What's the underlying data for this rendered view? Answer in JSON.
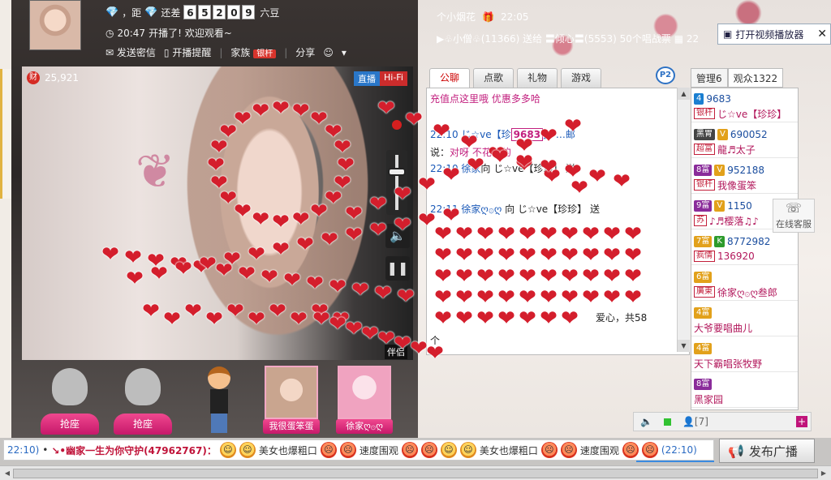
{
  "host": {
    "need_text_a": "，距",
    "need_text_b": "还差",
    "digits": [
      "6",
      "5",
      "2",
      "0",
      "9"
    ],
    "bean_text": "六豆",
    "time": "20:47",
    "status": "开播了! 欢迎观看~",
    "send_message": "发送密信",
    "start_reminder": "开播提醒",
    "family": "家族",
    "family_badge": "银杆",
    "share": "分享"
  },
  "video": {
    "wealth_icon": "财",
    "viewer_count": "25,921",
    "live_label": "直播",
    "quality_label": "Hi-Fi",
    "companion_label": "伴侣"
  },
  "seats": [
    {
      "label": "抢座"
    },
    {
      "label": "抢座"
    }
  ],
  "guards": [
    {
      "name": "我很蛋笨蛋"
    },
    {
      "name": "徐家ღ۞ღ"
    }
  ],
  "top_messages": {
    "line1_name": "个小烟花",
    "line1_time": "22:05",
    "line2": "▶♧小僧♧(11366) 送给 〓倾心〓(5553) 50个唱战票",
    "line2_tail": "22"
  },
  "player_popup": {
    "label": "打开视频播放器",
    "close": "✕"
  },
  "chat": {
    "pip_label": "P2",
    "tabs": [
      "公聊",
      "点歌",
      "礼物",
      "游戏"
    ],
    "lines": [
      {
        "pre": "",
        "text": "充值点这里哦  优惠多多哈",
        "post": ""
      },
      {
        "pre": "22:10 じ☆ve【珍",
        "text": "9683",
        "post": "】 …邮"
      },
      {
        "pre": "说：",
        "text": "对呀  不花钱的",
        "post": ""
      },
      {
        "pre": "22:10 徐家",
        "text": "",
        "post": "向 じ☆ve【珍珍】 送"
      },
      {
        "pre": "22:11 徐家ღ۞ღ",
        "text": "",
        "post": "向 じ☆ve【珍珍】 送"
      },
      {
        "pre": "",
        "text": "",
        "post": "爱心，共58"
      },
      {
        "pre": "个",
        "text": "",
        "post": ""
      }
    ]
  },
  "users_panel": {
    "tab_admin": "管理6",
    "tab_audience": "观众1322",
    "users": [
      {
        "level": "4",
        "tag": "",
        "num": "9683",
        "tag2": "银杆",
        "name": "じ☆ve【珍珍】",
        "lvclass": "bl"
      },
      {
        "level": "黑胃",
        "tag": "V",
        "num": "690052",
        "tag2": "超富",
        "name": "龍♬太子",
        "lvclass": "bk"
      },
      {
        "level": "8富",
        "tag": "V",
        "num": "952188",
        "tag2": "银杆",
        "name": "我像蛋笨",
        "lvclass": "pu"
      },
      {
        "level": "9富",
        "tag": "V",
        "num": "1150",
        "tag2": "苏",
        "name": "♪♬樱落♫♪",
        "lvclass": "pu"
      },
      {
        "level": "7富",
        "tag": "K",
        "num": "8772982",
        "tag2": "疯情",
        "name": "136920",
        "lvclass": "ye"
      },
      {
        "level": "6富",
        "tag": "",
        "num": "",
        "tag2": "廣東",
        "name": "徐家ღ۞ღ叁郎",
        "lvclass": "ye"
      },
      {
        "level": "4富",
        "tag": "",
        "num": "",
        "tag2": "",
        "name": "大爷要唱曲儿",
        "lvclass": "ye"
      },
      {
        "level": "4富",
        "tag": "",
        "num": "",
        "tag2": "",
        "name": "天下霸唱张牧野",
        "lvclass": "ye"
      },
      {
        "level": "8富",
        "tag": "",
        "num": "",
        "tag2": "",
        "name": "黑家园",
        "lvclass": "pu"
      }
    ]
  },
  "service": {
    "label": "在线客服"
  },
  "mini_bar": {
    "count": "[7]",
    "plus": "+"
  },
  "broadcast": {
    "time_start": "22:10)",
    "poster": "↘•幽家一生为你守护(47962767)：",
    "phrase1": "美女也爆粗口",
    "phrase2": "速度围观",
    "phrase3": "美女也爆粗口",
    "phrase4": "速度围观",
    "time_end": "(22:10)",
    "publish_label": "发布广播"
  },
  "colors": {
    "accent_pink": "#c6186a",
    "heart_red": "#d41e2c",
    "live_blue": "#2a77c9"
  }
}
